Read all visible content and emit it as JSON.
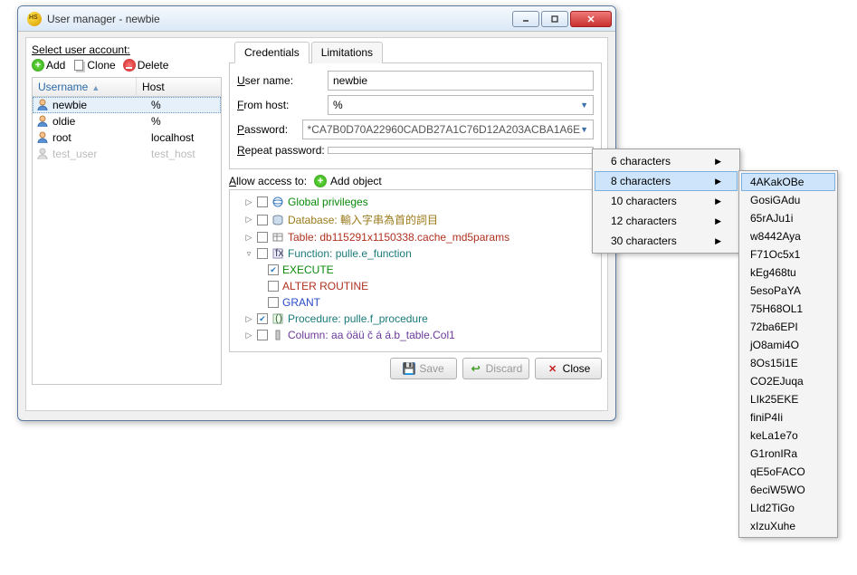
{
  "window": {
    "title": "User manager - newbie"
  },
  "left": {
    "select_label_pre": "S",
    "select_label_rest": "elect user account:",
    "add": "Add",
    "clone": "Clone",
    "delete": "Delete",
    "columns": {
      "username": "Username",
      "host": "Host"
    },
    "rows": [
      {
        "user": "newbie",
        "host": "%",
        "selected": true
      },
      {
        "user": "oldie",
        "host": "%",
        "selected": false
      },
      {
        "user": "root",
        "host": "localhost",
        "selected": false
      },
      {
        "user": "test_user",
        "host": "test_host",
        "selected": false,
        "gray": true
      }
    ]
  },
  "tabs": {
    "cred": "Credentials",
    "lim": "Limitations"
  },
  "cred": {
    "username_label_u": "U",
    "username_label_rest": "ser name:",
    "username_value": "newbie",
    "fromhost_label_u": "F",
    "fromhost_label_rest": "rom host:",
    "fromhost_value": "%",
    "password_label_u": "P",
    "password_label_rest": "assword:",
    "password_value": "*CA7B0D70A22960CADB27A1C76D12A203ACBA1A6E",
    "repeat_label_u": "R",
    "repeat_label_rest": "epeat password:",
    "repeat_value": ""
  },
  "access": {
    "label_u": "A",
    "label_rest": "llow access to:",
    "add_object": "Add object",
    "tree": {
      "global": "Global privileges",
      "database": "Database: 輸入字串為首的詞目",
      "table": "Table: db115291x1150338.cache_md5params",
      "function": "Function: pulle.e_function",
      "execute": "EXECUTE",
      "alter": "ALTER ROUTINE",
      "grant": "GRANT",
      "procedure": "Procedure: pulle.f_procedure",
      "column": "Column: aa öäü č á á.b_table.Col1"
    }
  },
  "buttons": {
    "save": "Save",
    "discard": "Discard",
    "close": "Close"
  },
  "menu1": [
    {
      "label": "6 characters"
    },
    {
      "label": "8 characters",
      "highlight": true
    },
    {
      "label": "10 characters"
    },
    {
      "label": "12 characters"
    },
    {
      "label": "30 characters"
    }
  ],
  "menu2": [
    "4AKakOBe",
    "GosiGAdu",
    "65rAJu1i",
    "w8442Aya",
    "F71Oc5x1",
    "kEg468tu",
    "5esoPaYA",
    "75H68OL1",
    "72ba6EPI",
    "jO8ami4O",
    "8Os15i1E",
    "CO2EJuqa",
    "LIk25EKE",
    "finiP4Ii",
    "keLa1e7o",
    "G1ronIRa",
    "qE5oFACO",
    "6eciW5WO",
    "LId2TiGo",
    "xIzuXuhe"
  ]
}
